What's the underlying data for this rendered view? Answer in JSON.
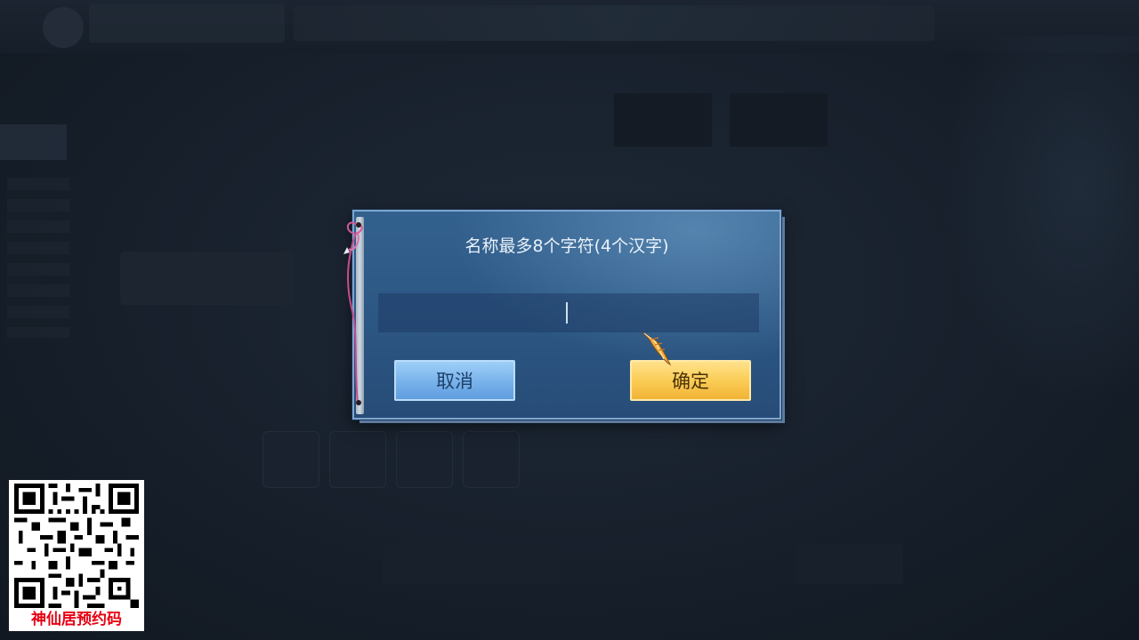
{
  "background": {
    "tabs": [
      "",
      "",
      "",
      "",
      ""
    ],
    "left_box_label": ""
  },
  "dialog": {
    "title": "名称最多8个字符(4个汉字)",
    "name_input": {
      "value": "",
      "placeholder": ""
    },
    "cancel_label": "取消",
    "confirm_label": "确定"
  },
  "promo": {
    "text": "神仙居预约码"
  },
  "colors": {
    "dialog_bg": "#2c5683",
    "cancel_button": "#7bb4ec",
    "confirm_button": "#fbcd56",
    "promo_text": "#e60012"
  },
  "icons": {
    "ribbon": "ribbon-icon",
    "cursor": "feather-cursor-icon",
    "qr": "qr-code-icon"
  }
}
